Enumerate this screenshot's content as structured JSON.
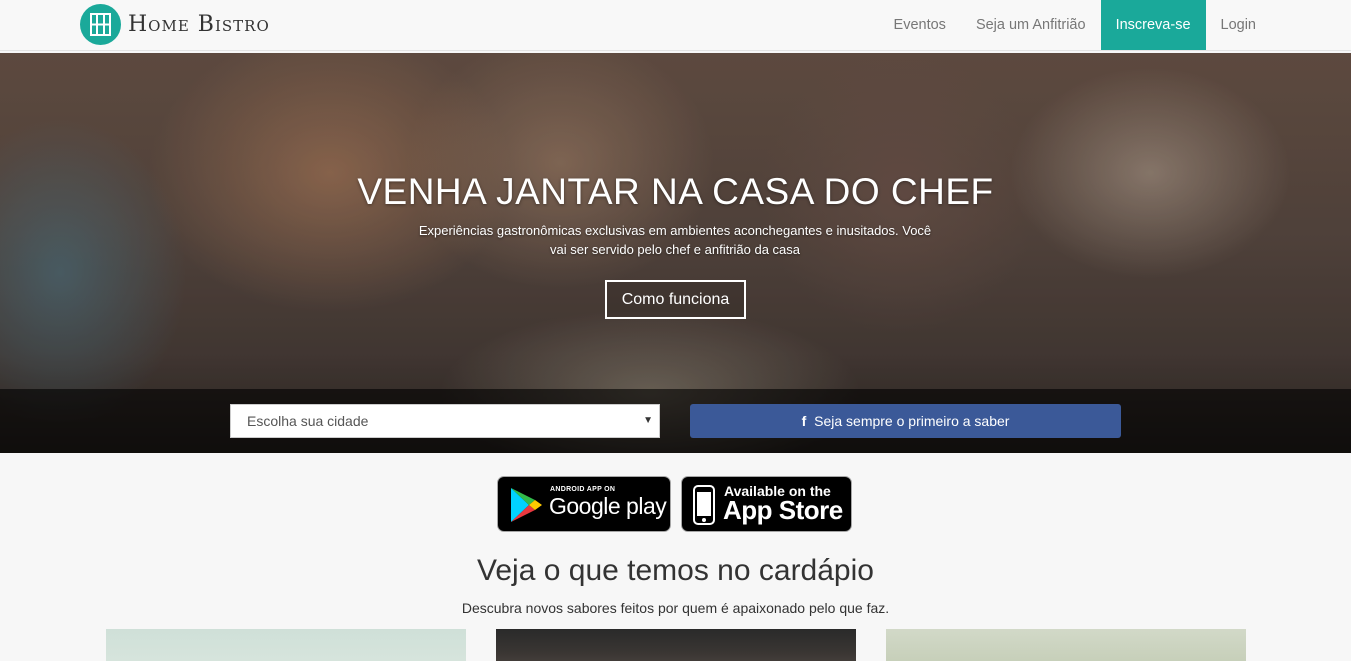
{
  "brand": {
    "name": "Home Bistro"
  },
  "nav": {
    "items": [
      {
        "label": "Eventos"
      },
      {
        "label": "Seja um Anfitrião"
      },
      {
        "label": "Inscreva-se"
      },
      {
        "label": "Login"
      }
    ]
  },
  "hero": {
    "title": "VENHA JANTAR NA CASA DO CHEF",
    "subtitle": "Experiências gastronômicas exclusivas em ambientes aconchegantes e inusitados. Você vai ser servido pelo chef e anfitrião da casa",
    "button_label": "Como funciona",
    "city_select_value": "Escolha sua cidade",
    "facebook_button_label": "Seja sempre o primeiro a saber"
  },
  "badges": {
    "google": {
      "small": "ANDROID APP ON",
      "big": "Google play"
    },
    "apple": {
      "small": "Available on the",
      "big": "App Store"
    }
  },
  "menu_section": {
    "title": "Veja o que temos no cardápio",
    "subtitle": "Descubra novos sabores feitos por quem é apaixonado pelo que faz."
  },
  "colors": {
    "accent": "#1aa99a",
    "facebook": "#3b5998"
  }
}
